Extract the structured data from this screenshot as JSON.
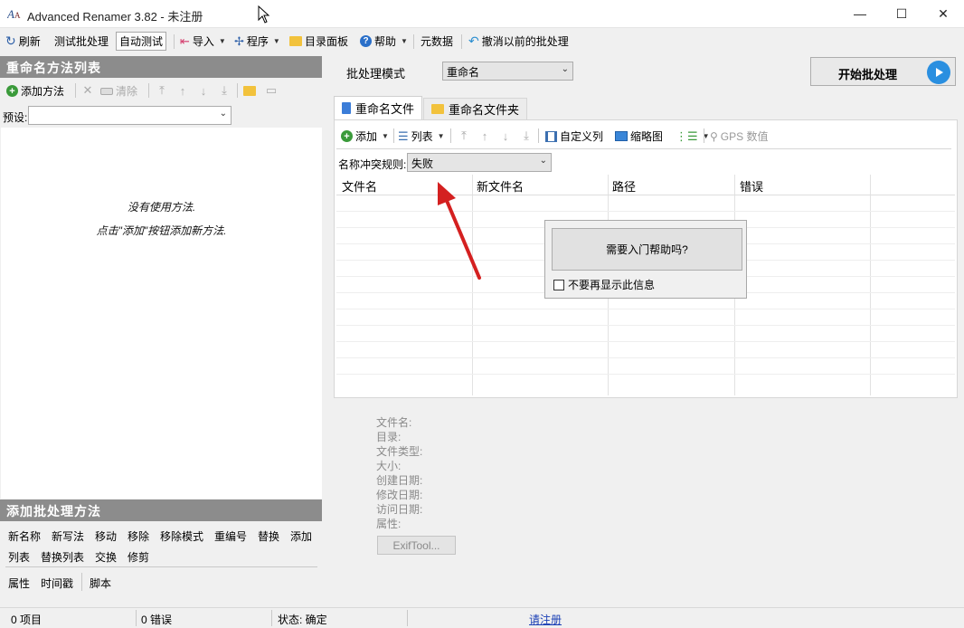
{
  "window": {
    "title": "Advanced Renamer 3.82 - 未注册",
    "minimize": "—",
    "maximize": "☐",
    "close": "✕"
  },
  "toolbar": {
    "refresh": "刷新",
    "test_batch": "测试批处理",
    "auto_test": "自动测试",
    "import": "导入",
    "program": "程序",
    "dir_panel": "目录面板",
    "help": "帮助",
    "metadata": "元数据",
    "undo_batch": "撤消以前的批处理"
  },
  "left_panel": {
    "header": "重命名方法列表",
    "add_method": "添加方法",
    "clear": "清除",
    "preset_label": "预设:",
    "preset_value": "",
    "empty_line1": "没有使用方法.",
    "empty_line2": "点击\"添加\"按钮添加新方法.",
    "add_header": "添加批处理方法",
    "methods_row1": [
      "新名称",
      "新写法",
      "移动",
      "移除",
      "移除模式",
      "重编号",
      "替换",
      "添加"
    ],
    "methods_row2": [
      "列表",
      "替换列表",
      "交换",
      "修剪"
    ],
    "methods_row3": [
      "属性",
      "时间戳",
      "脚本"
    ]
  },
  "batch": {
    "mode_label": "批处理模式",
    "mode_value": "重命名",
    "start_button": "开始批处理"
  },
  "tabs": [
    {
      "label": "重命名文件",
      "active": true
    },
    {
      "label": "重命名文件夹",
      "active": false
    }
  ],
  "file_toolbar": {
    "add": "添加",
    "list": "列表",
    "custom_columns": "自定义列",
    "thumbnails": "缩略图",
    "gps": "GPS 数值"
  },
  "conflict": {
    "label": "名称冲突规则:",
    "value": "失败"
  },
  "grid": {
    "columns": [
      "文件名",
      "新文件名",
      "路径",
      "错误"
    ]
  },
  "popup": {
    "help_button": "需要入门帮助吗?",
    "checkbox_label": "不要再显示此信息"
  },
  "file_info": {
    "labels": [
      "文件名:",
      "目录:",
      "文件类型:",
      "大小:",
      "创建日期:",
      "修改日期:",
      "访问日期:",
      "属性:"
    ],
    "exif_button": "ExifTool..."
  },
  "status": {
    "items": "0 项目",
    "errors": "0 错误",
    "state": "状态: 确定",
    "register": "请注册"
  },
  "colors": {
    "accent_blue": "#2a8fe0",
    "header_gray": "#8c8c8c",
    "annotation_arrow": "#d42020"
  }
}
